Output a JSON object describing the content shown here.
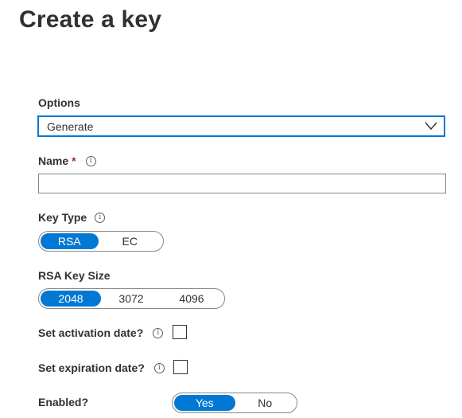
{
  "page": {
    "title": "Create a key"
  },
  "options": {
    "label": "Options",
    "selected": "Generate"
  },
  "name": {
    "label": "Name",
    "required_marker": "*",
    "value": ""
  },
  "key_type": {
    "label": "Key Type",
    "options": [
      "RSA",
      "EC"
    ],
    "selected": "RSA"
  },
  "rsa_key_size": {
    "label": "RSA Key Size",
    "options": [
      "2048",
      "3072",
      "4096"
    ],
    "selected": "2048"
  },
  "activation": {
    "label": "Set activation date?",
    "checked": false
  },
  "expiration": {
    "label": "Set expiration date?",
    "checked": false
  },
  "enabled": {
    "label": "Enabled?",
    "options": [
      "Yes",
      "No"
    ],
    "selected": "Yes"
  },
  "icons": {
    "info": "info-icon",
    "dropdown": "chevron-down-icon"
  },
  "colors": {
    "accent": "#0078d4",
    "required": "#a4262c",
    "text": "#323130",
    "border": "#8a8886"
  }
}
